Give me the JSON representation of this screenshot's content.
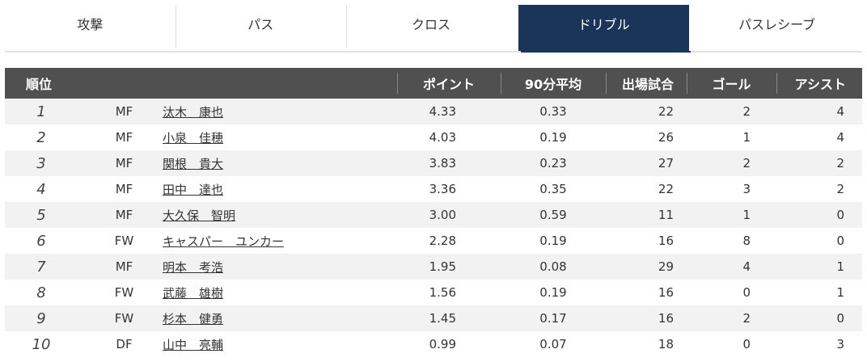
{
  "tabs": [
    {
      "label": "攻撃",
      "active": false
    },
    {
      "label": "パス",
      "active": false
    },
    {
      "label": "クロス",
      "active": false
    },
    {
      "label": "ドリブル",
      "active": true
    },
    {
      "label": "パスレシーブ",
      "active": false
    }
  ],
  "table": {
    "headers": {
      "rank": "順位",
      "points": "ポイント",
      "per90": "90分平均",
      "games": "出場試合",
      "goals": "ゴール",
      "assists": "アシスト"
    },
    "rows": [
      {
        "rank": "1",
        "pos": "MF",
        "name": "汰木　康也",
        "points": "4.33",
        "per90": "0.33",
        "games": "22",
        "goals": "2",
        "assists": "4"
      },
      {
        "rank": "2",
        "pos": "MF",
        "name": "小泉　佳穂",
        "points": "4.03",
        "per90": "0.19",
        "games": "26",
        "goals": "1",
        "assists": "4"
      },
      {
        "rank": "3",
        "pos": "MF",
        "name": "関根　貴大",
        "points": "3.83",
        "per90": "0.23",
        "games": "27",
        "goals": "2",
        "assists": "2"
      },
      {
        "rank": "4",
        "pos": "MF",
        "name": "田中　達也",
        "points": "3.36",
        "per90": "0.35",
        "games": "22",
        "goals": "3",
        "assists": "2"
      },
      {
        "rank": "5",
        "pos": "MF",
        "name": "大久保　智明",
        "points": "3.00",
        "per90": "0.59",
        "games": "11",
        "goals": "1",
        "assists": "0"
      },
      {
        "rank": "6",
        "pos": "FW",
        "name": "キャスパー　ユンカー",
        "points": "2.28",
        "per90": "0.19",
        "games": "16",
        "goals": "8",
        "assists": "0"
      },
      {
        "rank": "7",
        "pos": "MF",
        "name": "明本　考浩",
        "points": "1.95",
        "per90": "0.08",
        "games": "29",
        "goals": "4",
        "assists": "1"
      },
      {
        "rank": "8",
        "pos": "FW",
        "name": "武藤　雄樹",
        "points": "1.56",
        "per90": "0.19",
        "games": "16",
        "goals": "0",
        "assists": "1"
      },
      {
        "rank": "9",
        "pos": "FW",
        "name": "杉本　健勇",
        "points": "1.45",
        "per90": "0.17",
        "games": "16",
        "goals": "2",
        "assists": "0"
      },
      {
        "rank": "10",
        "pos": "DF",
        "name": "山中　亮輔",
        "points": "0.99",
        "per90": "0.07",
        "games": "18",
        "goals": "0",
        "assists": "3"
      }
    ]
  },
  "colors": {
    "active_tab": "#1b3558",
    "header_bg": "#505050",
    "row_stripe": "#f2f2f2"
  }
}
